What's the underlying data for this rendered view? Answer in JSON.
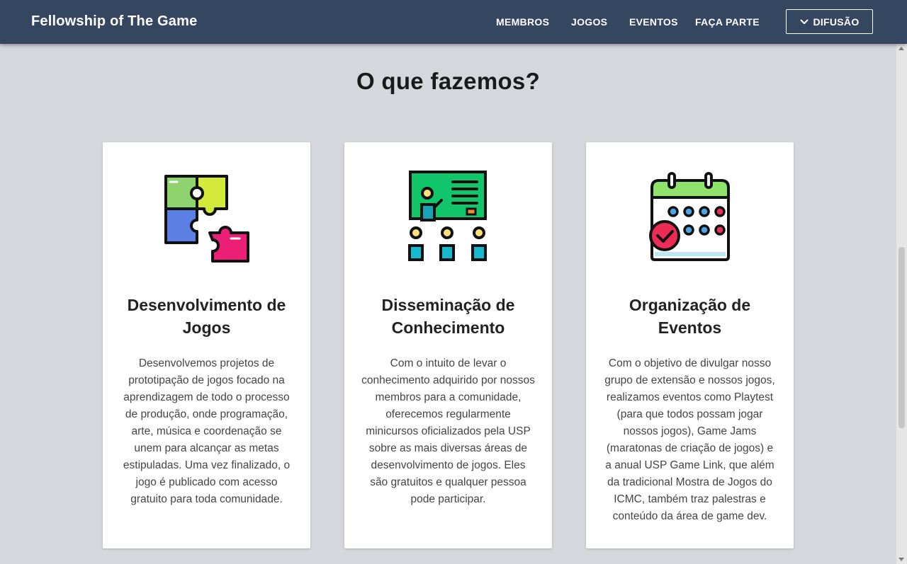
{
  "navbar": {
    "brand": "Fellowship of The Game",
    "links": [
      "MEMBROS",
      "JOGOS",
      "EVENTOS",
      "FAÇA PARTE"
    ],
    "dropdown_label": "DIFUSÃO",
    "dropdown_icon": "chevron-down-icon",
    "background": "#354660"
  },
  "section": {
    "title": "O que fazemos?"
  },
  "cards": [
    {
      "icon": "puzzle-icon",
      "title": "Desenvolvimento de Jogos",
      "text": "Desenvolvemos projetos de prototipação de jogos focado na aprendizagem de todo o processo de produção, onde programação, arte, música e coordenação se unem para alcançar as metas estipuladas. Uma vez finalizado, o jogo é publicado com acesso gratuito para toda comunidade."
    },
    {
      "icon": "classroom-icon",
      "title": "Disseminação de Conhecimento",
      "text": "Com o intuito de levar o conhecimento adquirido por nossos membros para a comunidade, oferecemos regularmente minicursos oficializados pela USP sobre as mais diversas áreas de desenvolvimento de jogos. Eles são gratuitos e qualquer pessoa pode participar."
    },
    {
      "icon": "calendar-icon",
      "title": "Organização de Eventos",
      "text": "Com o objetivo de divulgar nosso grupo de extensão e nossos jogos, realizamos eventos como Playtest (para que todos possam jogar nossos jogos), Game Jams (maratonas de criação de jogos) e a anual USP Game Link, que além da tradicional Mostra de Jogos do ICMC, também traz palestras e conteúdo da área de game dev."
    }
  ]
}
